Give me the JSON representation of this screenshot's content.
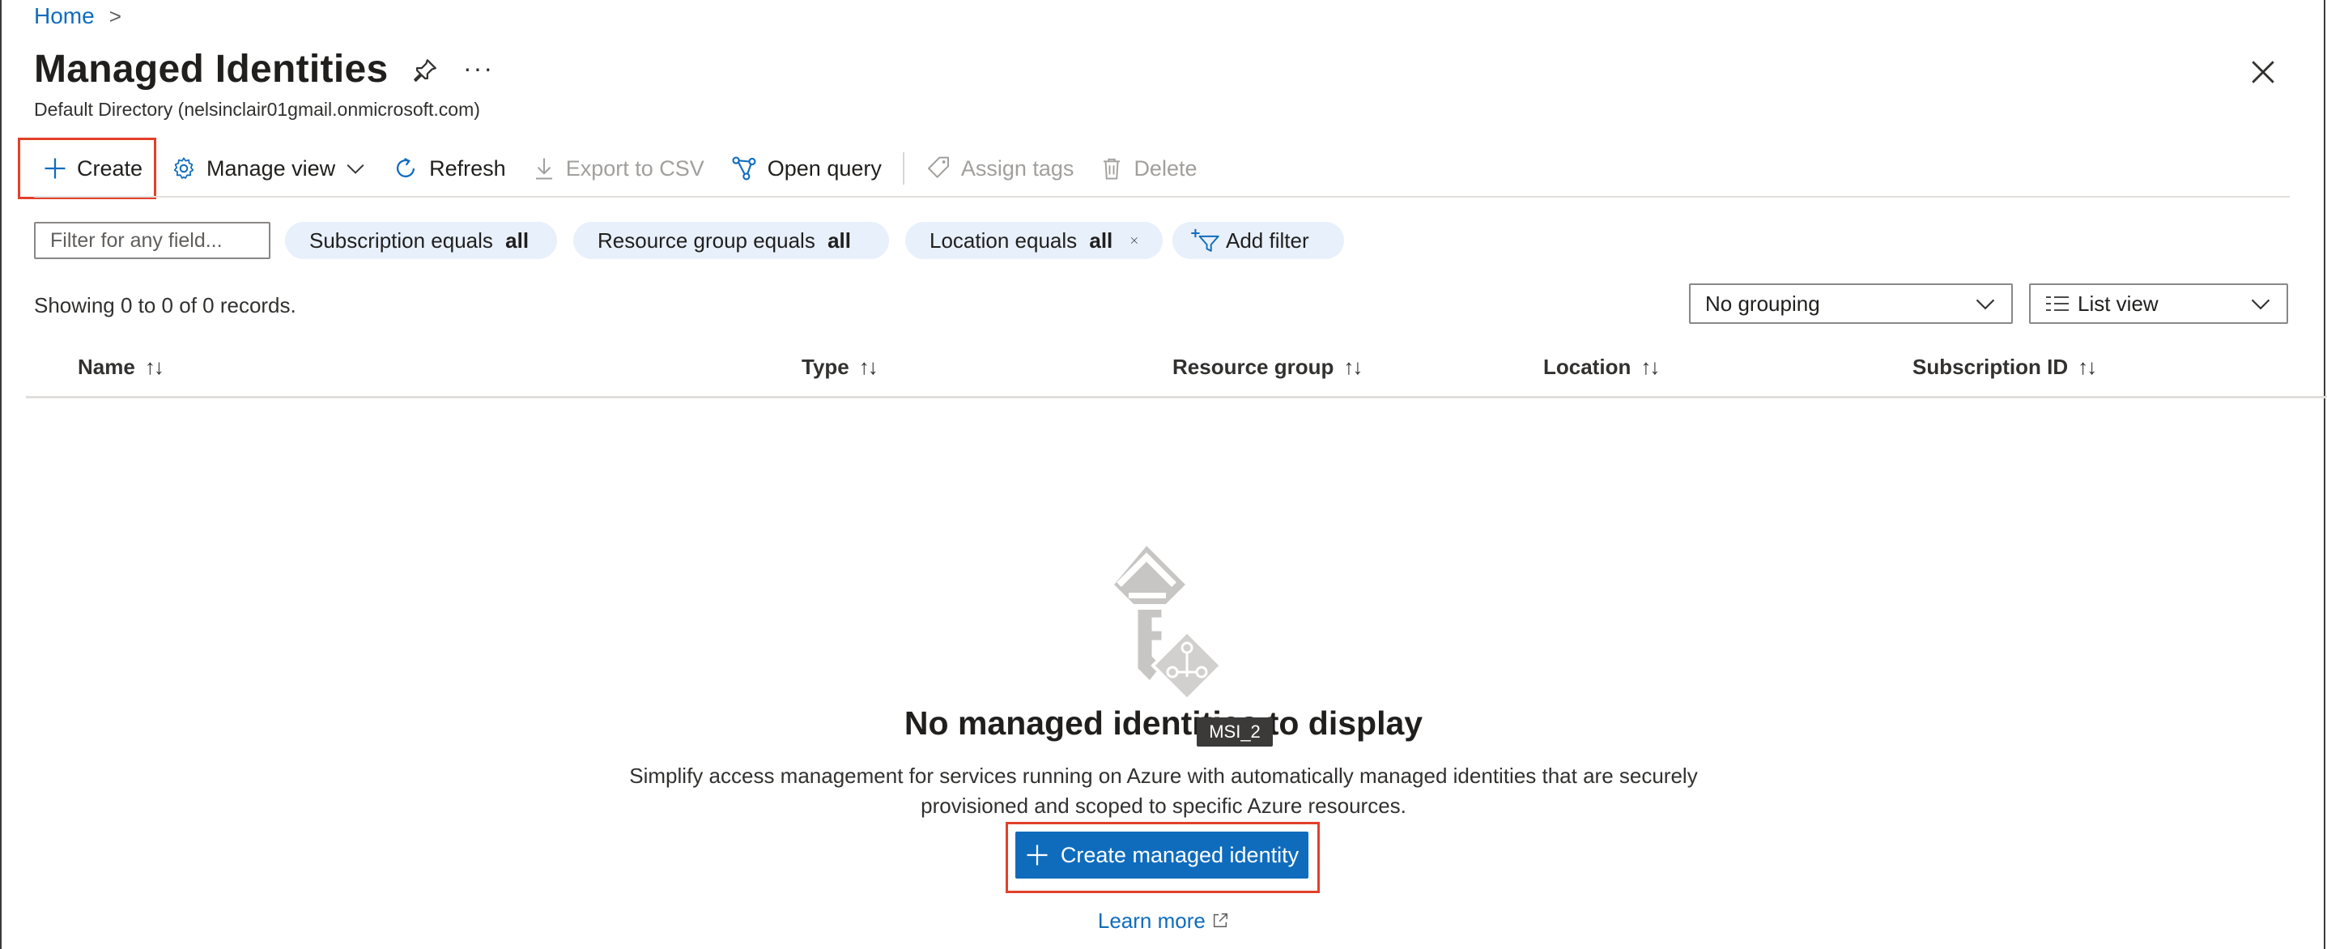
{
  "breadcrumb": {
    "home": "Home",
    "sep": ">"
  },
  "header": {
    "title": "Managed Identities",
    "subtitle": "Default Directory (nelsinclair01gmail.onmicrosoft.com)",
    "more": "···"
  },
  "toolbar": {
    "create": "Create",
    "manage_view": "Manage view",
    "refresh": "Refresh",
    "export_csv": "Export to CSV",
    "open_query": "Open query",
    "assign_tags": "Assign tags",
    "delete": "Delete"
  },
  "filters": {
    "placeholder": "Filter for any field...",
    "pills": [
      {
        "label": "Subscription equals ",
        "value": "all"
      },
      {
        "label": "Resource group equals ",
        "value": "all"
      },
      {
        "label": "Location equals ",
        "value": "all"
      }
    ],
    "add_filter": "Add filter"
  },
  "list": {
    "showing": "Showing 0 to 0 of 0 records.",
    "grouping": "No grouping",
    "view": "List view",
    "columns": [
      "Name",
      "Type",
      "Resource group",
      "Location",
      "Subscription ID"
    ],
    "sort_glyph": "↑↓"
  },
  "empty_state": {
    "title": "No managed identities to display",
    "tooltip": "MSI_2",
    "description_line1": "Simplify access management for services running on Azure with automatically managed identities that are securely",
    "description_line2": "provisioned and scoped to specific Azure resources.",
    "cta": "Create managed identity",
    "learn_more": "Learn more"
  },
  "colors": {
    "accent": "#0f6cbd",
    "highlight_border": "#e2402b",
    "pill_bg": "#e8f0fb"
  }
}
